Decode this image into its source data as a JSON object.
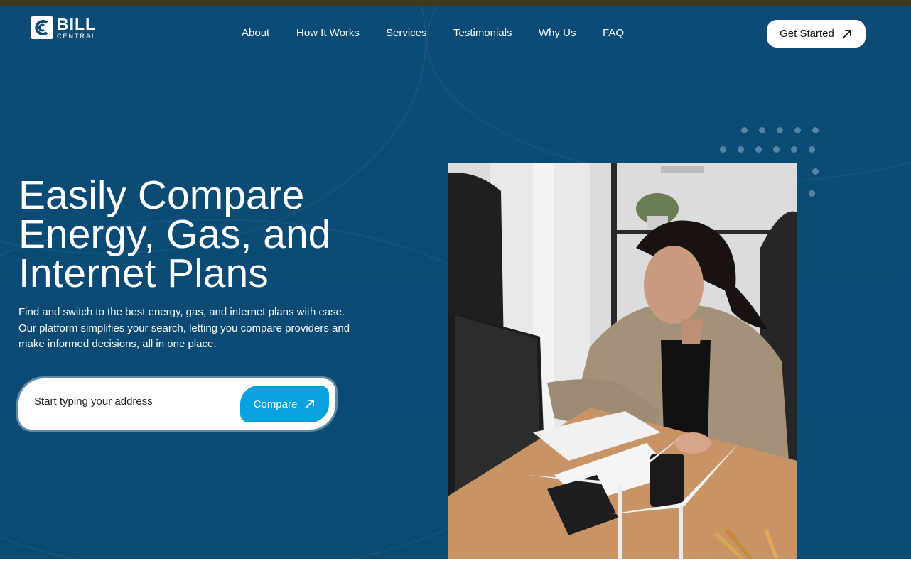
{
  "brand": {
    "name_line1": "BILL",
    "name_line2": "CENTRAL"
  },
  "nav": {
    "items": [
      {
        "label": "About"
      },
      {
        "label": "How It Works"
      },
      {
        "label": "Services"
      },
      {
        "label": "Testimonials"
      },
      {
        "label": "Why Us"
      },
      {
        "label": "FAQ"
      }
    ],
    "cta_label": "Get Started",
    "cta_icon": "arrow-up-right-icon"
  },
  "hero": {
    "headline_line1": "Easily Compare",
    "headline_line2": "Energy, Gas, and",
    "headline_line3": "Internet Plans",
    "description": "Find and switch to the best energy, gas, and internet plans with ease. Our platform simplifies your search, letting you compare providers and make informed decisions, all in one place.",
    "search": {
      "placeholder": "Start typing your address",
      "button_label": "Compare",
      "button_icon": "arrow-up-right-icon"
    },
    "image": "woman-working-at-desk-photo"
  },
  "colors": {
    "hero_bg": "#0b4a74",
    "accent": "#0aa1e0",
    "top_bar": "#3d3a22"
  }
}
